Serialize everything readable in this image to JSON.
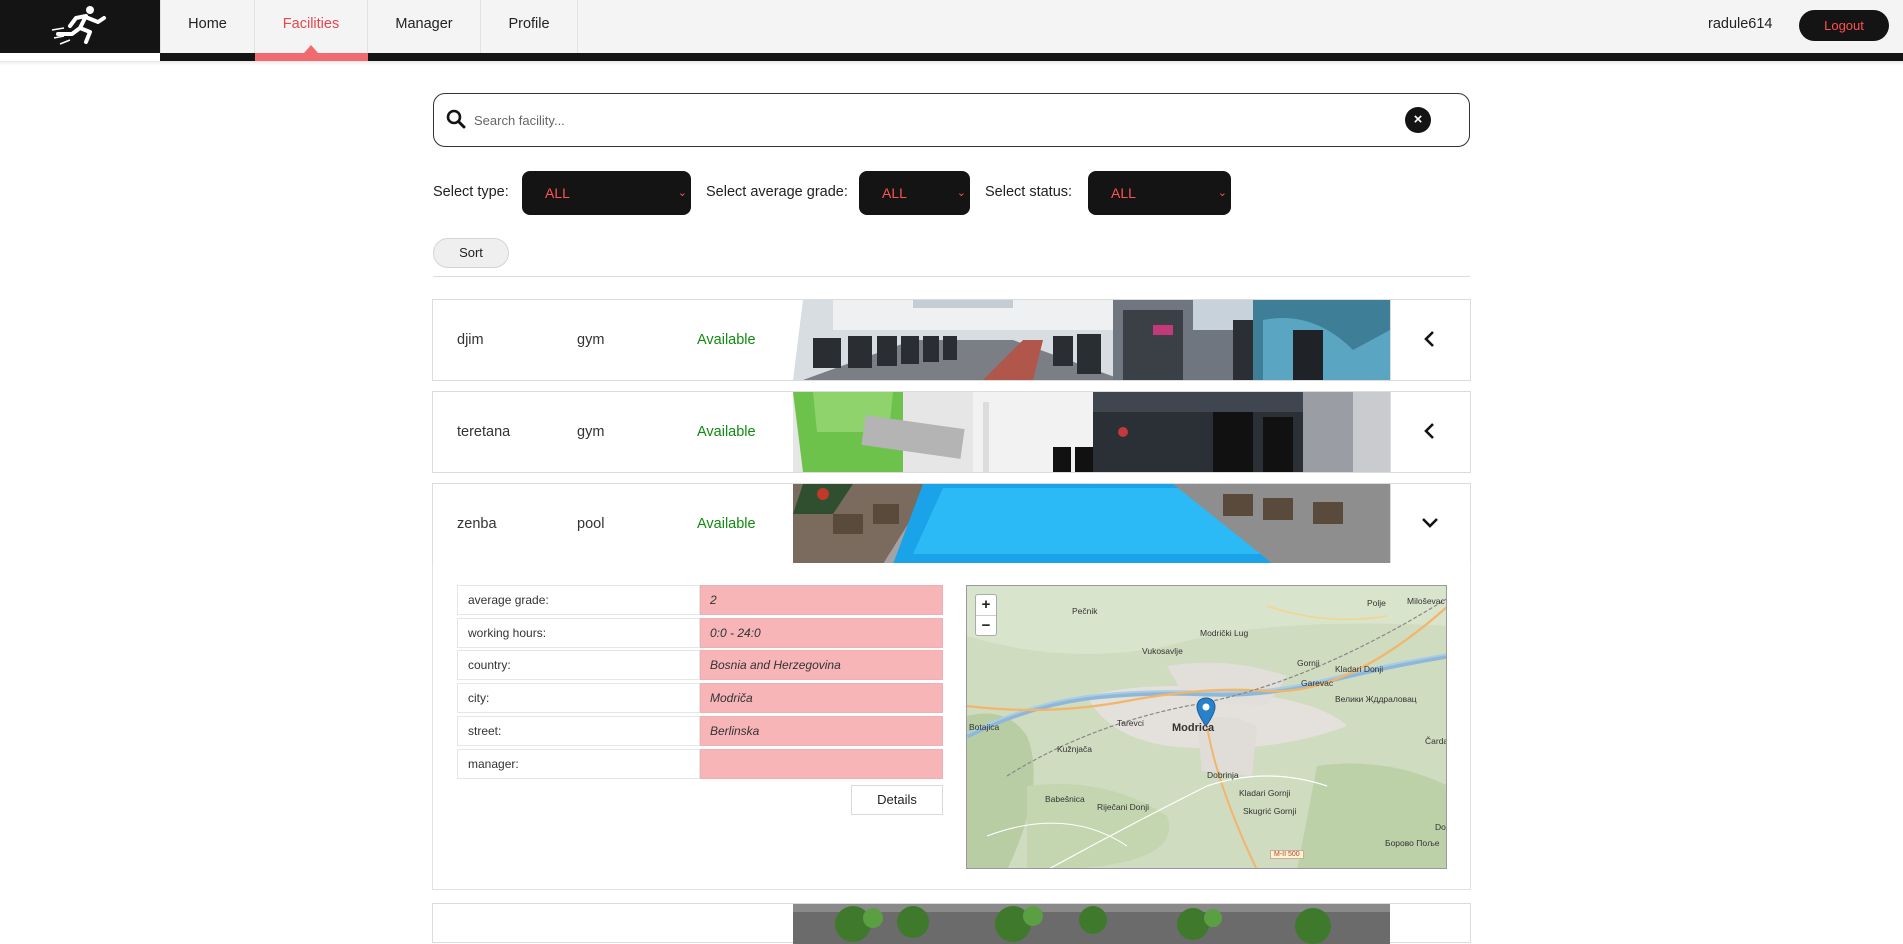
{
  "nav": {
    "items": [
      {
        "label": "Home"
      },
      {
        "label": "Facilities"
      },
      {
        "label": "Manager"
      },
      {
        "label": "Profile"
      }
    ],
    "active": "Facilities",
    "username": "radule614",
    "logout_label": "Logout"
  },
  "search": {
    "placeholder": "Search facility...",
    "value": ""
  },
  "filters": {
    "type_label": "Select type:",
    "type_value": "ALL",
    "grade_label": "Select average grade:",
    "grade_value": "ALL",
    "status_label": "Select status:",
    "status_value": "ALL"
  },
  "sort_label": "Sort",
  "facilities": [
    {
      "name": "djim",
      "type": "gym",
      "status": "Available",
      "expanded": false
    },
    {
      "name": "teretana",
      "type": "gym",
      "status": "Available",
      "expanded": false
    },
    {
      "name": "zenba",
      "type": "pool",
      "status": "Available",
      "expanded": true
    }
  ],
  "details": {
    "rows": [
      {
        "label": "average grade:",
        "value": "2"
      },
      {
        "label": "working hours:",
        "value": "0:0 - 24:0"
      },
      {
        "label": "country:",
        "value": "Bosnia and Herzegovina"
      },
      {
        "label": "city:",
        "value": "Modriča"
      },
      {
        "label": "street:",
        "value": "Berlinska"
      },
      {
        "label": "manager:",
        "value": ""
      }
    ],
    "details_button": "Details"
  },
  "map": {
    "zoom_in": "+",
    "zoom_out": "−",
    "labels": {
      "pecnik": "Pečnik",
      "modricki_lug": "Modrički Lug",
      "vukosavlje": "Vukosavlje",
      "polje": "Polje",
      "milosevac": "Miloševac",
      "gornji": "Gornji",
      "kladari_donji": "Kladari Donji",
      "garevac": "Garevac",
      "velika_zhd": "Велики Жддраловац",
      "botajica": "Botajica",
      "tarevci": "Tarevci",
      "modrica": "Modriča",
      "cardak": "Čardak",
      "kuzmjaca": "Kužnjača",
      "dobrinja": "Dobrinja",
      "babesnica": "Babešnica",
      "rijecani_donji": "Riječani Donji",
      "kladari_gornji": "Kladari Gornji",
      "skugric_gornji": "Skugrić Gornji",
      "borovo_polje": "Борово Поље",
      "do": "Do",
      "road": "M-II 500"
    }
  },
  "colors": {
    "accent": "#e5484d",
    "dark": "#141414",
    "available": "#108a10",
    "detail_value_bg": "#f7b5b8"
  }
}
